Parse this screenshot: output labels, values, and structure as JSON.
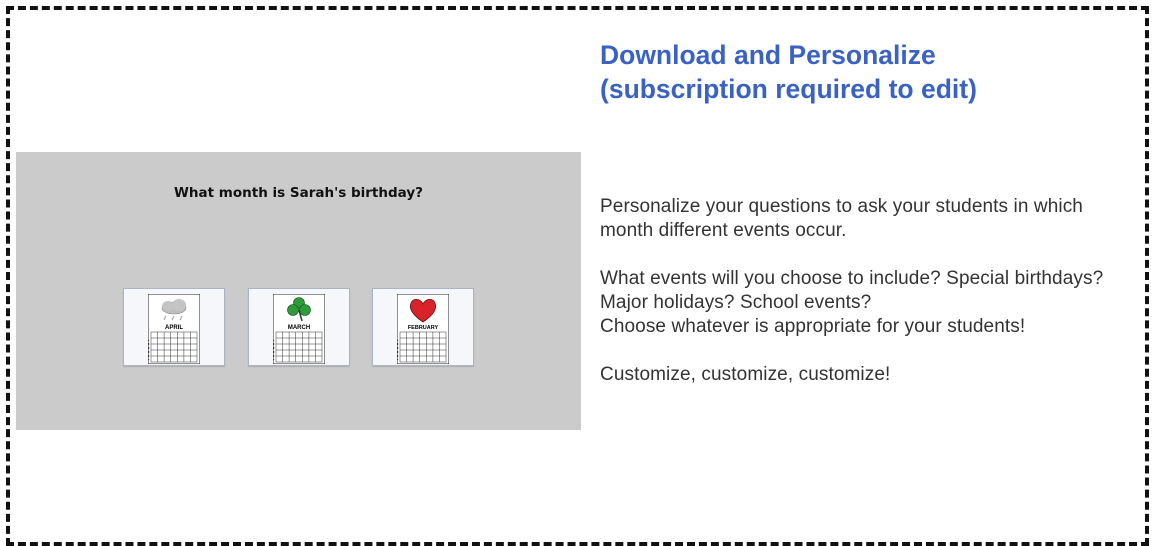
{
  "heading": {
    "line1": "Download and Personalize",
    "line2": "(subscription required to edit)",
    "color": "#3a62c4"
  },
  "preview": {
    "question": "What month is Sarah's birthday?",
    "background": "#cbcbcb",
    "cards": [
      {
        "month": "APRIL",
        "icon": "rain-cloud-icon"
      },
      {
        "month": "MARCH",
        "icon": "shamrock-icon"
      },
      {
        "month": "FEBRUARY",
        "icon": "heart-icon"
      }
    ]
  },
  "description": {
    "para1": "Personalize your questions to ask your students in which month different events occur.",
    "para2a": "What events will you choose to include? Special birthdays? Major holidays? School events?",
    "para2b": "Choose whatever is appropriate for your students!",
    "para3": "Customize, customize, customize!"
  }
}
